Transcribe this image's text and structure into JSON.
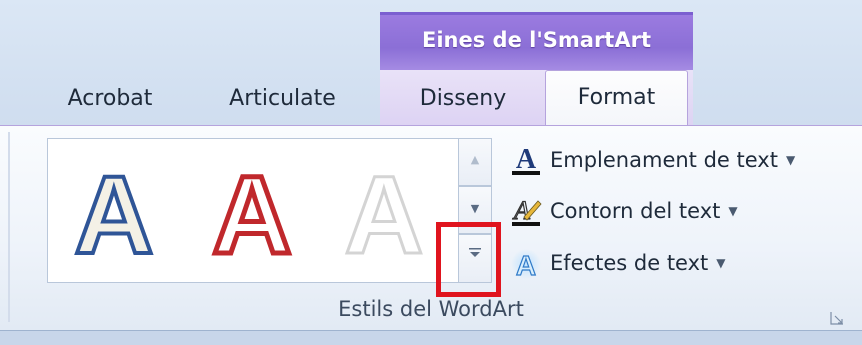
{
  "context_tab_group": {
    "title": "Eines de l'SmartArt"
  },
  "tabs": [
    {
      "label": "Acrobat",
      "active": false
    },
    {
      "label": "Articulate",
      "active": false
    },
    {
      "label": "Disseny",
      "active": false
    },
    {
      "label": "Format",
      "active": true
    }
  ],
  "wordart_gallery": {
    "styles": [
      {
        "glyph": "A",
        "fill": "#f4f1e6",
        "outline": "#2f5597"
      },
      {
        "glyph": "A",
        "fill": "#ffffff",
        "outline": "#c0282c"
      },
      {
        "glyph": "A",
        "fill": "#ffffff",
        "outline": "#d9d9d9"
      }
    ],
    "scroll_up_icon": "▲",
    "scroll_down_icon": "▼",
    "more_icon": "▾"
  },
  "commands": [
    {
      "label": "Emplenament de text",
      "icon": "text-fill-icon"
    },
    {
      "label": "Contorn del text",
      "icon": "text-outline-icon"
    },
    {
      "label": "Efectes de text",
      "icon": "text-effects-icon"
    }
  ],
  "group": {
    "label": "Estils del WordArt"
  },
  "colors": {
    "context_accent": "#8b6fd6",
    "highlight_box": "#e0141e"
  }
}
